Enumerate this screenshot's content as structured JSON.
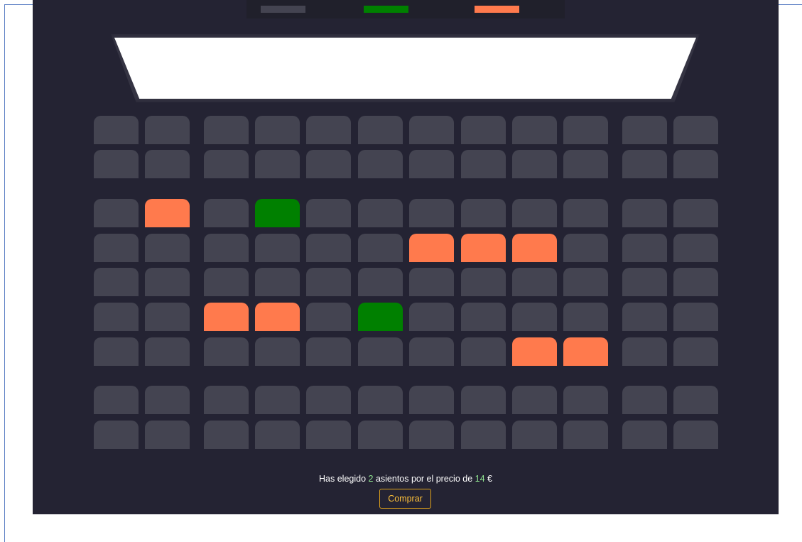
{
  "legend": {
    "items": [
      {
        "state": "available",
        "color": "#444451"
      },
      {
        "state": "selected",
        "color": "#008000"
      },
      {
        "state": "occupied",
        "color": "#ff7a4d"
      }
    ]
  },
  "seat_colors": {
    "available": "#444451",
    "selected": "#008000",
    "occupied": "#ff7a4d"
  },
  "seats": {
    "rows": [
      [
        "available",
        "available",
        "available",
        "available",
        "available",
        "available",
        "available",
        "available",
        "available",
        "available",
        "available",
        "available"
      ],
      [
        "available",
        "available",
        "available",
        "available",
        "available",
        "available",
        "available",
        "available",
        "available",
        "available",
        "available",
        "available"
      ],
      [
        "available",
        "occupied",
        "available",
        "selected",
        "available",
        "available",
        "available",
        "available",
        "available",
        "available",
        "available",
        "available"
      ],
      [
        "available",
        "available",
        "available",
        "available",
        "available",
        "available",
        "occupied",
        "occupied",
        "occupied",
        "available",
        "available",
        "available"
      ],
      [
        "available",
        "available",
        "available",
        "available",
        "available",
        "available",
        "available",
        "available",
        "available",
        "available",
        "available",
        "available"
      ],
      [
        "available",
        "available",
        "occupied",
        "occupied",
        "available",
        "selected",
        "available",
        "available",
        "available",
        "available",
        "available",
        "available"
      ],
      [
        "available",
        "available",
        "available",
        "available",
        "available",
        "available",
        "available",
        "available",
        "occupied",
        "occupied",
        "available",
        "available"
      ],
      [
        "available",
        "available",
        "available",
        "available",
        "available",
        "available",
        "available",
        "available",
        "available",
        "available",
        "available",
        "available"
      ],
      [
        "available",
        "available",
        "available",
        "available",
        "available",
        "available",
        "available",
        "available",
        "available",
        "available",
        "available",
        "available"
      ]
    ]
  },
  "summary": {
    "prefix": "Has elegido",
    "count": "2",
    "middle": "asientos por el precio de",
    "price": "14",
    "currency": "€"
  },
  "buy_button": {
    "label": "Comprar"
  }
}
